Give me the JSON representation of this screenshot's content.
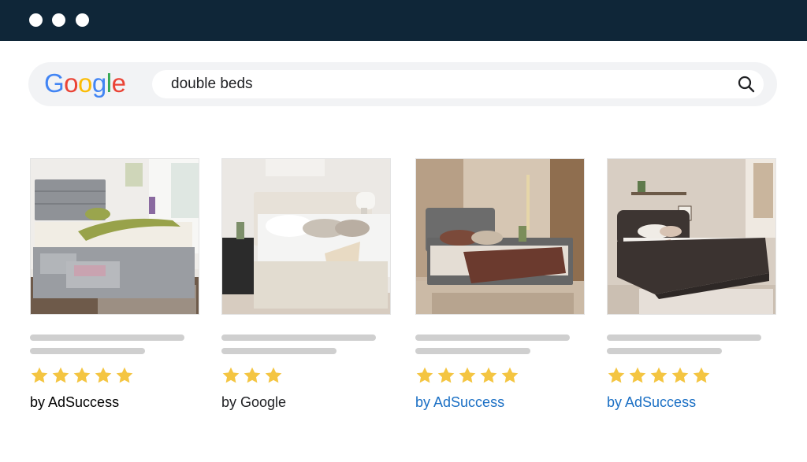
{
  "window": {
    "controls": [
      "window-dot",
      "window-dot",
      "window-dot"
    ]
  },
  "search": {
    "logo_letters": [
      {
        "char": "G",
        "color": "#4285F4"
      },
      {
        "char": "o",
        "color": "#EA4335"
      },
      {
        "char": "o",
        "color": "#FBBC05"
      },
      {
        "char": "g",
        "color": "#4285F4"
      },
      {
        "char": "l",
        "color": "#34A853"
      },
      {
        "char": "e",
        "color": "#EA4335"
      }
    ],
    "query": "double beds",
    "icon": "search-icon"
  },
  "results": [
    {
      "image": "grey-divan-bed-with-drawers",
      "rating": 5,
      "seller": "by AdSuccess",
      "sponsored": true
    },
    {
      "image": "cream-upholstered-bed",
      "rating": 3,
      "seller": "by Google",
      "sponsored": false
    },
    {
      "image": "grey-wingback-bed",
      "rating": 5,
      "seller": "by AdSuccess",
      "sponsored": true
    },
    {
      "image": "dark-leather-sleigh-bed",
      "rating": 5,
      "seller": "by AdSuccess",
      "sponsored": true
    }
  ],
  "colors": {
    "titlebar": "#0f2638",
    "star": "#f4c542",
    "sponsored_link": "#1a6fc4",
    "placeholder_line": "#cfcfcf"
  }
}
